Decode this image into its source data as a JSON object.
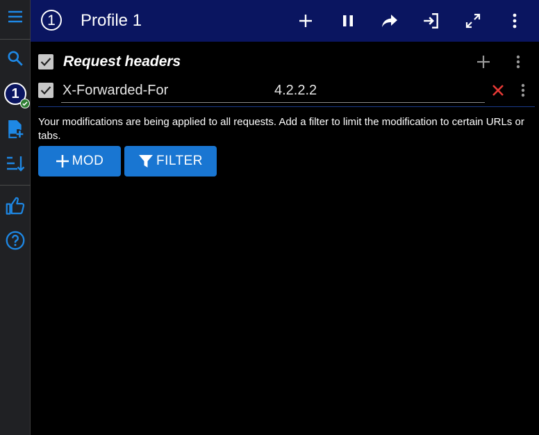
{
  "sidebar": {
    "profile_number": "1",
    "items": [
      "menu-icon",
      "search-icon",
      "profile-1",
      "add-file-icon",
      "sort-icon",
      "thumbs-up-icon",
      "help-icon"
    ]
  },
  "topbar": {
    "profile_number": "1",
    "title": "Profile 1",
    "icons": [
      "plus-icon",
      "pause-icon",
      "share-icon",
      "import-icon",
      "expand-icon",
      "more-vert-icon"
    ]
  },
  "section": {
    "title": "Request headers",
    "enabled": true
  },
  "header_row": {
    "name": "X-Forwarded-For",
    "value": "4.2.2.2",
    "enabled": true
  },
  "info_text": "Your modifications are being applied to all requests. Add a filter to limit the modification to certain URLs or tabs.",
  "buttons": {
    "mod_label": "MOD",
    "filter_label": "FILTER"
  },
  "colors": {
    "topbar": "#0a1560",
    "accent": "#1976d2",
    "sidebar_icon": "#1e88e5",
    "delete": "#e53935",
    "status_ok": "#2e7d32"
  }
}
